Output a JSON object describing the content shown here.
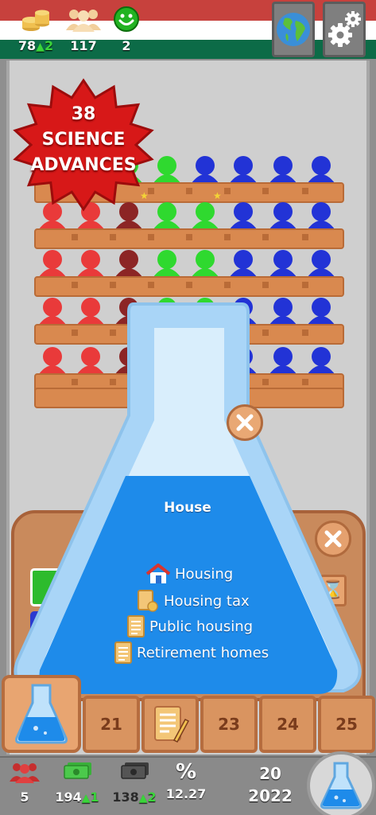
{
  "colors": {
    "flag_red": "#c7413d",
    "flag_white": "#ffffff",
    "flag_green": "#0c6b47",
    "seat_red": "#e93a3a",
    "seat_darkred": "#8c2525",
    "seat_green": "#2fd92f",
    "seat_blue": "#2233d6",
    "bench_brown": "#d9894f",
    "flask_blue": "#1e8bea",
    "badge_red": "#d71818"
  },
  "topbar": {
    "money": {
      "icon": "coins-icon",
      "value": "78",
      "delta": "2"
    },
    "population": {
      "icon": "crowd-icon",
      "value": "117"
    },
    "happiness": {
      "icon": "smiley-icon",
      "value": "2"
    },
    "world_button": {
      "icon": "globe-icon"
    },
    "settings_button": {
      "icon": "gears-icon"
    }
  },
  "badge": {
    "line1": "38",
    "line2": "SCIENCE",
    "line3": "ADVANCES"
  },
  "popup": {
    "title": "House",
    "items": [
      {
        "icon": "house-icon",
        "label": "Housing"
      },
      {
        "icon": "coins-icon",
        "label": "Housing tax"
      },
      {
        "icon": "document-icon",
        "label": "Public housing"
      },
      {
        "icon": "document-icon",
        "label": "Retirement homes"
      }
    ]
  },
  "tabs": [
    {
      "kind": "flask"
    },
    {
      "label": "21"
    },
    {
      "kind": "document"
    },
    {
      "label": "23"
    },
    {
      "label": "24"
    },
    {
      "label": "25"
    }
  ],
  "bottombar": {
    "seats": {
      "icon": "people-icon",
      "value": "5"
    },
    "income": {
      "icon": "banknotes-icon",
      "value": "194",
      "delta": "1"
    },
    "expenses": {
      "icon": "dark-banknotes-icon",
      "value": "138",
      "delta": "2"
    },
    "rate": {
      "icon": "percent-icon",
      "symbol": "%",
      "value": "12.27"
    },
    "date": {
      "day": "20",
      "year": "2022"
    },
    "science_button": {
      "icon": "flask-icon"
    }
  }
}
